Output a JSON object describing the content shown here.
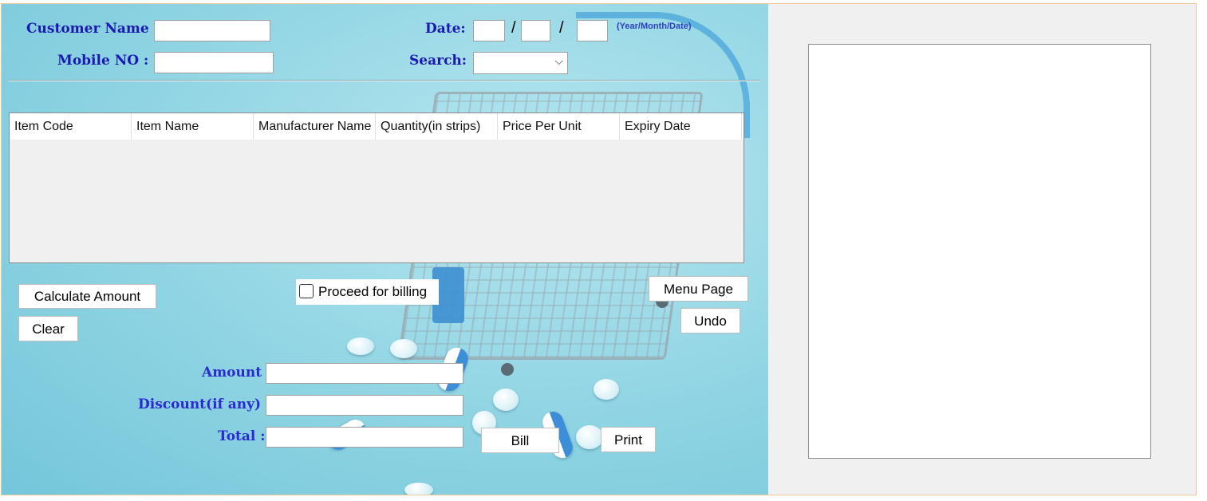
{
  "form": {
    "customer_name_label": "Customer Name :",
    "customer_name_value": "",
    "mobile_label": "Mobile NO :",
    "mobile_value": "",
    "date_label": "Date:",
    "date_year": "",
    "date_month": "",
    "date_day": "",
    "date_separator": "/",
    "date_hint": "(Year/Month/Date)",
    "search_label": "Search:",
    "search_value": ""
  },
  "table": {
    "columns": [
      "Item Code",
      "Item Name",
      "Manufacturer Name",
      "Quantity(in strips)",
      "Price Per Unit",
      "Expiry Date"
    ],
    "rows": []
  },
  "buttons": {
    "calculate": "Calculate Amount",
    "clear": "Clear",
    "proceed_billing": "Proceed for billing",
    "menu_page": "Menu Page",
    "undo": "Undo",
    "bill": "Bill",
    "print": "Print"
  },
  "totals": {
    "amount_label": "Amount :",
    "amount_value": "",
    "discount_label": "Discount(if any) :",
    "discount_value": "",
    "total_label": "Total :",
    "total_value": ""
  },
  "checkbox": {
    "proceed_checked": false
  },
  "colors": {
    "label_blue": "#1a1ab0",
    "panel_bg": "#f0f0f0",
    "accent_blue": "#3c8ed8"
  },
  "preview": {
    "content": ""
  }
}
